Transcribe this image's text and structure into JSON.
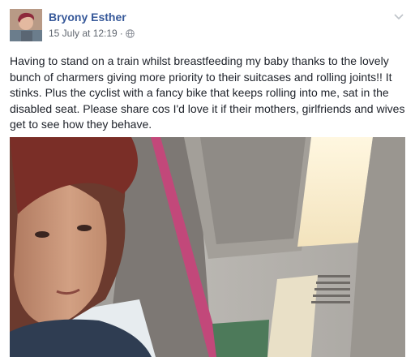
{
  "post": {
    "author": "Bryony Esther",
    "date": "15 July at 12:19",
    "separator": "·",
    "audience_icon": "globe-icon",
    "menu_icon": "chevron-down-icon",
    "text": "Having to stand on a train whilst breastfeeding my baby thanks to the lovely bunch of charmers giving more priority to their suitcases and rolling joints!! It stinks. Plus the cyclist with a fancy bike that keeps rolling into me, sat in the disabled seat. Please share cos I'd love it if their mothers, girlfriends and wives get to see how they behave.",
    "link_color": "#365899"
  }
}
